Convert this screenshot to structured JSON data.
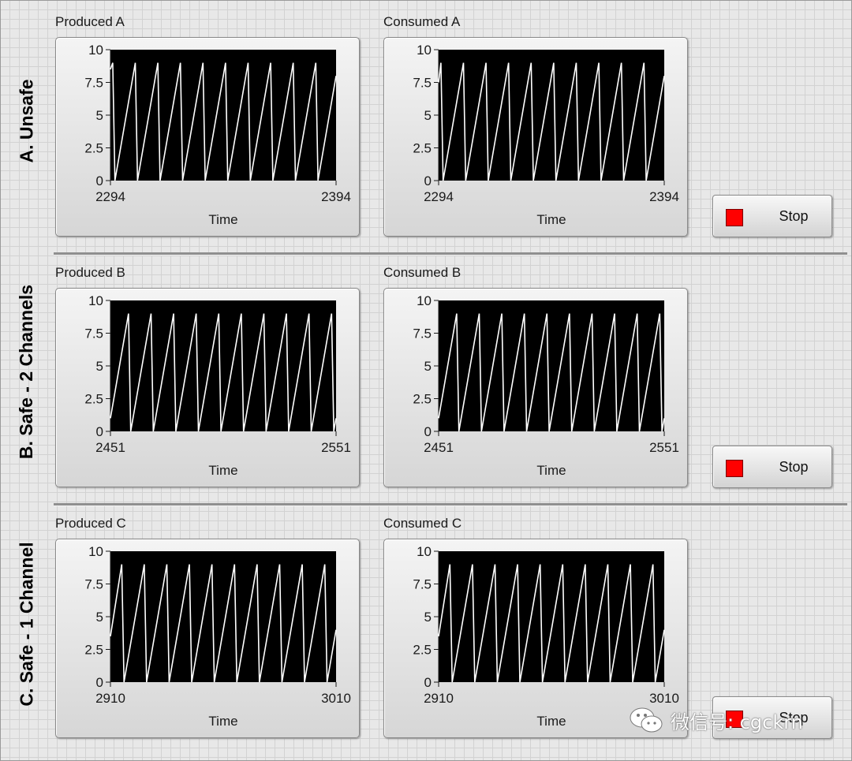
{
  "sections": [
    {
      "label": "A. Unsafe",
      "stop_label": "Stop",
      "charts": [
        {
          "title": "Produced A",
          "x_axis_label": "Time",
          "x_min": "2294",
          "x_max": "2394"
        },
        {
          "title": "Consumed A",
          "x_axis_label": "Time",
          "x_min": "2294",
          "x_max": "2394"
        }
      ]
    },
    {
      "label": "B. Safe - 2 Channels",
      "stop_label": "Stop",
      "charts": [
        {
          "title": "Produced B",
          "x_axis_label": "Time",
          "x_min": "2451",
          "x_max": "2551"
        },
        {
          "title": "Consumed B",
          "x_axis_label": "Time",
          "x_min": "2451",
          "x_max": "2551"
        }
      ]
    },
    {
      "label": "C. Safe - 1 Channel",
      "stop_label": "Stop",
      "charts": [
        {
          "title": "Produced C",
          "x_axis_label": "Time",
          "x_min": "2910",
          "x_max": "3010"
        },
        {
          "title": "Consumed C",
          "x_axis_label": "Time",
          "x_min": "2910",
          "x_max": "3010"
        }
      ]
    }
  ],
  "y_ticks": [
    "10",
    "7.5",
    "5",
    "2.5",
    "0"
  ],
  "colors": {
    "plot_background": "#000000",
    "trace": "#ffffff",
    "stop_led": "#ff0000"
  },
  "watermark": {
    "text": "微信号: cgckrn",
    "icon": "wechat-icon"
  },
  "chart_data": [
    {
      "type": "line",
      "title": "Produced A",
      "xlabel": "Time",
      "ylabel": "",
      "xlim": [
        2294,
        2394
      ],
      "ylim": [
        0,
        10
      ],
      "grid": false,
      "series": [
        {
          "x": [
            2294,
            2295,
            2296,
            2305,
            2306,
            2315,
            2316,
            2325,
            2326,
            2335,
            2336,
            2345,
            2346,
            2355,
            2356,
            2365,
            2366,
            2375,
            2376,
            2385,
            2386,
            2394
          ],
          "values": [
            8.5,
            9,
            0,
            9,
            0,
            9,
            0,
            9,
            0,
            9,
            0,
            9,
            0,
            9,
            0,
            9,
            0,
            9,
            0,
            9,
            0,
            8
          ]
        }
      ]
    },
    {
      "type": "line",
      "title": "Consumed A",
      "xlabel": "Time",
      "ylabel": "",
      "xlim": [
        2294,
        2394
      ],
      "ylim": [
        0,
        10
      ],
      "grid": false,
      "series": [
        {
          "x": [
            2294,
            2295,
            2296,
            2305,
            2306,
            2315,
            2316,
            2325,
            2326,
            2335,
            2336,
            2345,
            2346,
            2355,
            2356,
            2365,
            2366,
            2375,
            2376,
            2385,
            2386,
            2394
          ],
          "values": [
            7.5,
            9,
            0,
            9,
            0,
            9,
            0,
            9,
            0,
            9,
            0,
            9,
            0,
            9,
            0,
            9,
            0,
            9,
            0,
            9,
            0,
            8
          ]
        }
      ]
    },
    {
      "type": "line",
      "title": "Produced B",
      "xlabel": "Time",
      "ylabel": "",
      "xlim": [
        2451,
        2551
      ],
      "ylim": [
        0,
        10
      ],
      "grid": false,
      "series": [
        {
          "x": [
            2451,
            2459,
            2460,
            2469,
            2470,
            2479,
            2480,
            2489,
            2490,
            2499,
            2500,
            2509,
            2510,
            2519,
            2520,
            2529,
            2530,
            2539,
            2540,
            2549,
            2550,
            2551
          ],
          "values": [
            1,
            9,
            0,
            9,
            0,
            9,
            0,
            9,
            0,
            9,
            0,
            9,
            0,
            9,
            0,
            9,
            0,
            9,
            0,
            9,
            0,
            1
          ]
        }
      ]
    },
    {
      "type": "line",
      "title": "Consumed B",
      "xlabel": "Time",
      "ylabel": "",
      "xlim": [
        2451,
        2551
      ],
      "ylim": [
        0,
        10
      ],
      "grid": false,
      "series": [
        {
          "x": [
            2451,
            2459,
            2460,
            2469,
            2470,
            2479,
            2480,
            2489,
            2490,
            2499,
            2500,
            2509,
            2510,
            2519,
            2520,
            2529,
            2530,
            2539,
            2540,
            2549,
            2550,
            2551
          ],
          "values": [
            1,
            9,
            0,
            9,
            0,
            9,
            0,
            9,
            0,
            9,
            0,
            9,
            0,
            9,
            0,
            9,
            0,
            9,
            0,
            9,
            0,
            1
          ]
        }
      ]
    },
    {
      "type": "line",
      "title": "Produced C",
      "xlabel": "Time",
      "ylabel": "",
      "xlim": [
        2910,
        3010
      ],
      "ylim": [
        0,
        10
      ],
      "grid": false,
      "series": [
        {
          "x": [
            2910,
            2915,
            2916,
            2925,
            2926,
            2935,
            2936,
            2945,
            2946,
            2955,
            2956,
            2965,
            2966,
            2975,
            2976,
            2985,
            2986,
            2995,
            2996,
            3005,
            3006,
            3010
          ],
          "values": [
            3.5,
            9,
            0,
            9,
            0,
            9,
            0,
            9,
            0,
            9,
            0,
            9,
            0,
            9,
            0,
            9,
            0,
            9,
            0,
            9,
            0,
            4
          ]
        }
      ]
    },
    {
      "type": "line",
      "title": "Consumed C",
      "xlabel": "Time",
      "ylabel": "",
      "xlim": [
        2910,
        3010
      ],
      "ylim": [
        0,
        10
      ],
      "grid": false,
      "series": [
        {
          "x": [
            2910,
            2915,
            2916,
            2925,
            2926,
            2935,
            2936,
            2945,
            2946,
            2955,
            2956,
            2965,
            2966,
            2975,
            2976,
            2985,
            2986,
            2995,
            2996,
            3005,
            3006,
            3010
          ],
          "values": [
            3.5,
            9,
            0,
            9,
            0,
            9,
            0,
            9,
            0,
            9,
            0,
            9,
            0,
            9,
            0,
            9,
            0,
            9,
            0,
            9,
            0,
            4
          ]
        }
      ]
    }
  ]
}
